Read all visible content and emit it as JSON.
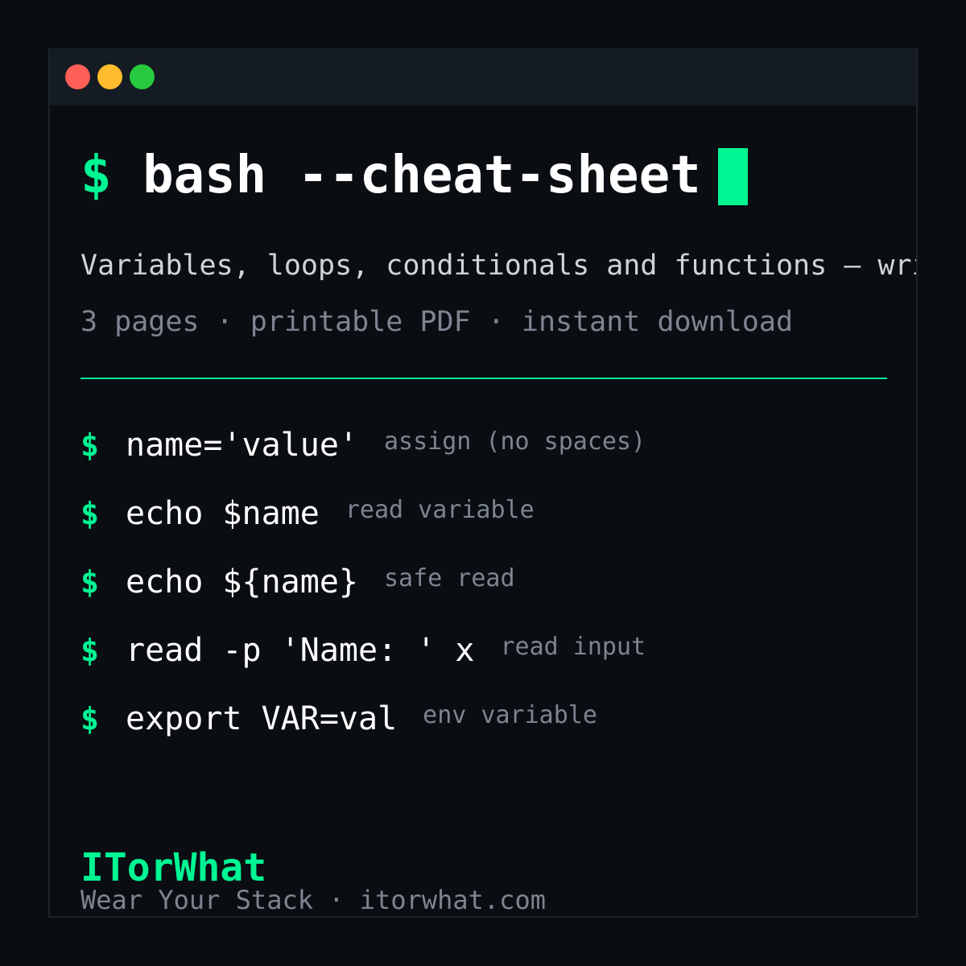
{
  "window": {
    "controls": [
      "close",
      "minimize",
      "maximize"
    ],
    "colors": {
      "close": "#ff5f56",
      "minimize": "#ffbd2e",
      "maximize": "#27c93f"
    }
  },
  "header": {
    "prompt": "$",
    "title": "bash --cheat-sheet",
    "subtitle": "Variables, loops, conditionals and functions — wri",
    "meta": "3 pages · printable PDF · instant download"
  },
  "commands": [
    {
      "prompt": "$",
      "code": "name='value'",
      "desc": "assign (no spaces)"
    },
    {
      "prompt": "$",
      "code": "echo $name",
      "desc": "read variable"
    },
    {
      "prompt": "$",
      "code": "echo ${name}",
      "desc": "safe read"
    },
    {
      "prompt": "$",
      "code": "read -p 'Name: ' x",
      "desc": "read input"
    },
    {
      "prompt": "$",
      "code": "export VAR=val",
      "desc": "env variable"
    }
  ],
  "footer": {
    "brand": "ITorWhat",
    "tagline": "Wear Your Stack · itorwhat.com"
  },
  "colors": {
    "accent": "#00f593",
    "background": "#0a0d12",
    "titlebar": "#151b22",
    "muted": "#7c8590"
  }
}
